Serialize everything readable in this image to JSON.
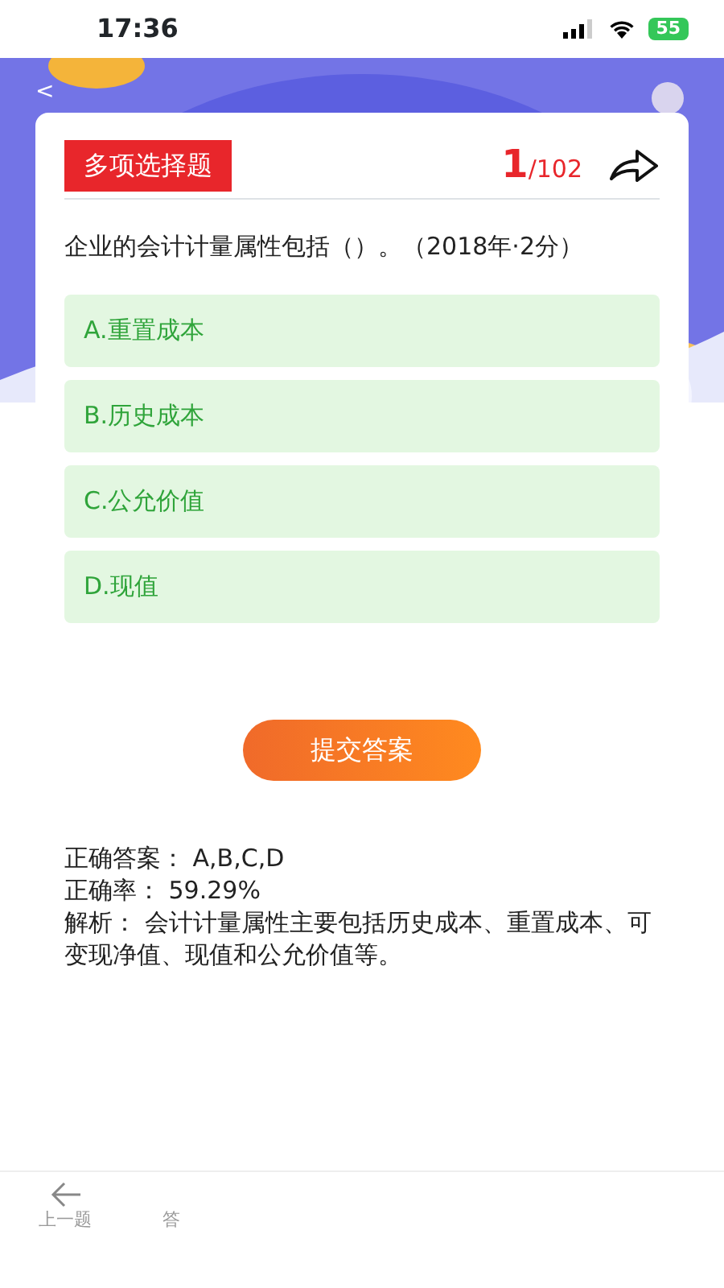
{
  "status_bar": {
    "time": "17:36",
    "battery": "55"
  },
  "back": "<",
  "question": {
    "type_tag": "多项选择题",
    "index": "1",
    "total": "/102",
    "text": "企业的会计计量属性包括（）。（2018年·2分）"
  },
  "options": [
    {
      "label": "A.重置成本"
    },
    {
      "label": "B.历史成本"
    },
    {
      "label": "C.公允价值"
    },
    {
      "label": "D.现值"
    }
  ],
  "submit_button": "提交答案",
  "result": [
    "正确答案：  A,B,C,D",
    "正确率：  59.29%",
    "解析：  会计计量属性主要包括历史成本、重置成本、可变现净值、现值和公允价值等。"
  ],
  "bottom_nav": [
    {
      "label": "上一题",
      "kind": "prev"
    },
    {
      "label": "答",
      "kind": "cut"
    }
  ]
}
